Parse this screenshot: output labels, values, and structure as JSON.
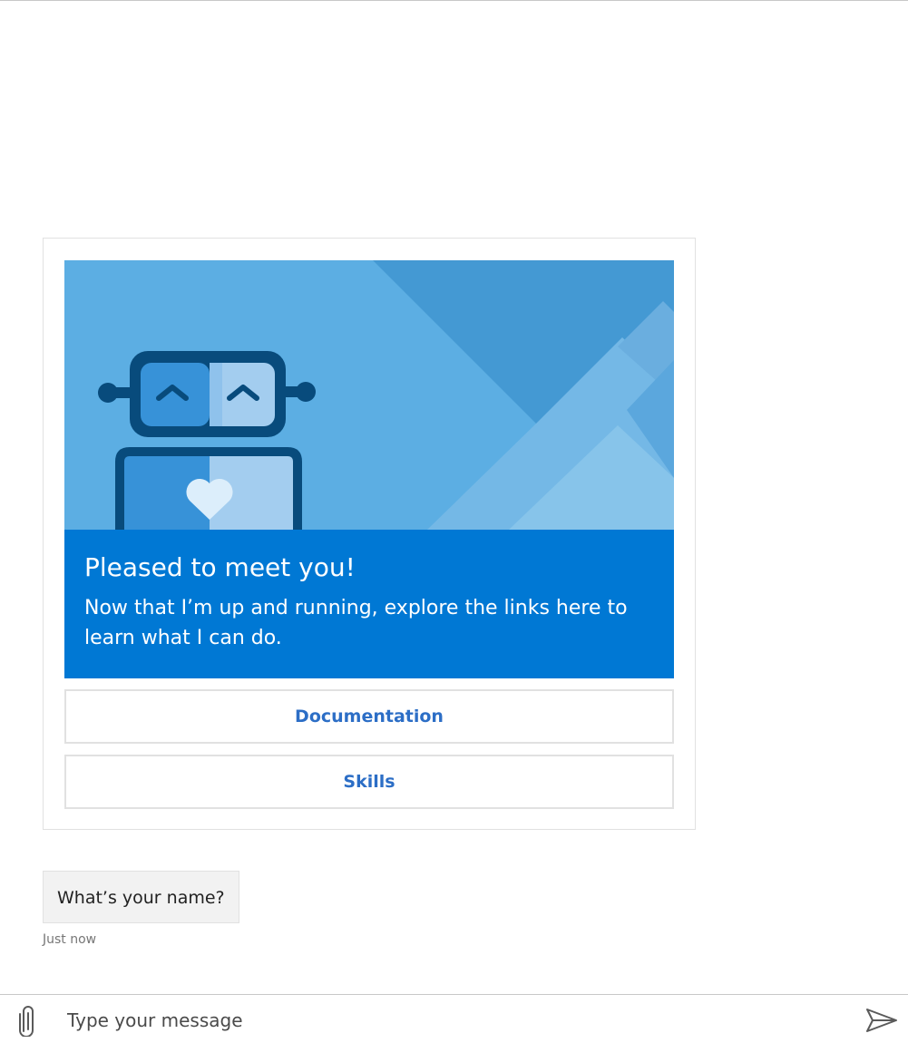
{
  "card": {
    "title": "Pleased to meet you!",
    "text": "Now that I’m up and running, explore the links here to learn what I can do.",
    "actions": [
      {
        "label": "Documentation"
      },
      {
        "label": "Skills"
      }
    ]
  },
  "message": {
    "text": "What’s your name?",
    "timestamp": "Just now"
  },
  "composer": {
    "placeholder": "Type your message",
    "attach_icon": "paperclip-icon",
    "send_icon": "send-icon"
  },
  "colors": {
    "accent": "#0078d4",
    "link": "#2c6ec6",
    "hero_bg": "#5caee3"
  }
}
